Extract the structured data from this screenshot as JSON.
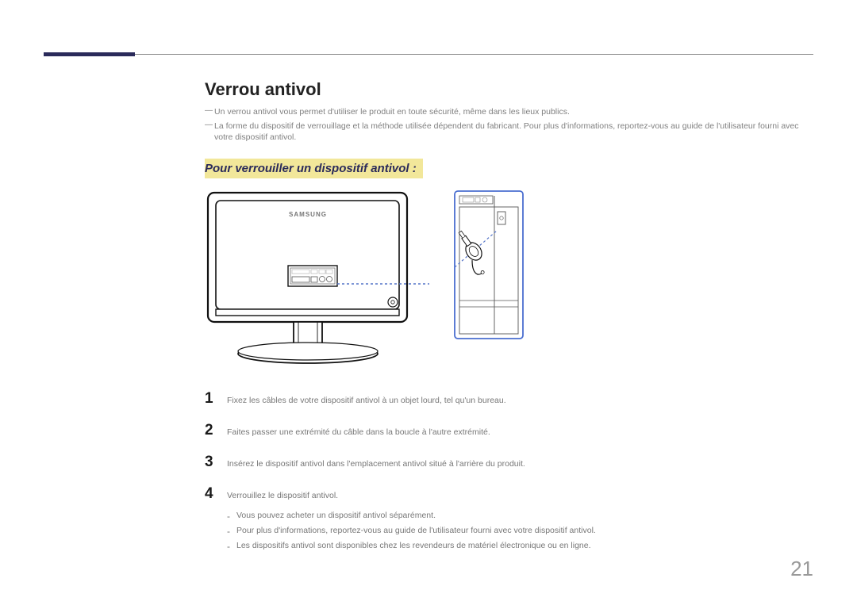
{
  "section_title": "Verrou antivol",
  "notes": [
    "Un verrou antivol vous permet d'utiliser le produit en toute sécurité, même dans les lieux publics.",
    "La forme du dispositif de verrouillage et la méthode utilisée dépendent du fabricant. Pour plus d'informations, reportez-vous au guide de l'utilisateur fourni avec votre dispositif antivol."
  ],
  "sub_title": "Pour verrouiller un dispositif antivol :",
  "monitor_brand": "SAMSUNG",
  "steps": [
    {
      "num": "1",
      "text": "Fixez les câbles de votre dispositif antivol à un objet lourd, tel qu'un bureau."
    },
    {
      "num": "2",
      "text": "Faites passer une extrémité du câble dans la boucle à l'autre extrémité."
    },
    {
      "num": "3",
      "text": "Insérez le dispositif antivol dans l'emplacement antivol situé à l'arrière du produit."
    },
    {
      "num": "4",
      "text": "Verrouillez le dispositif antivol."
    }
  ],
  "sub_notes": [
    "Vous pouvez acheter un dispositif antivol séparément.",
    "Pour plus d'informations, reportez-vous au guide de l'utilisateur fourni avec votre dispositif antivol.",
    "Les dispositifs antivol sont disponibles chez les revendeurs de matériel électronique ou en ligne."
  ],
  "page_number": "21"
}
